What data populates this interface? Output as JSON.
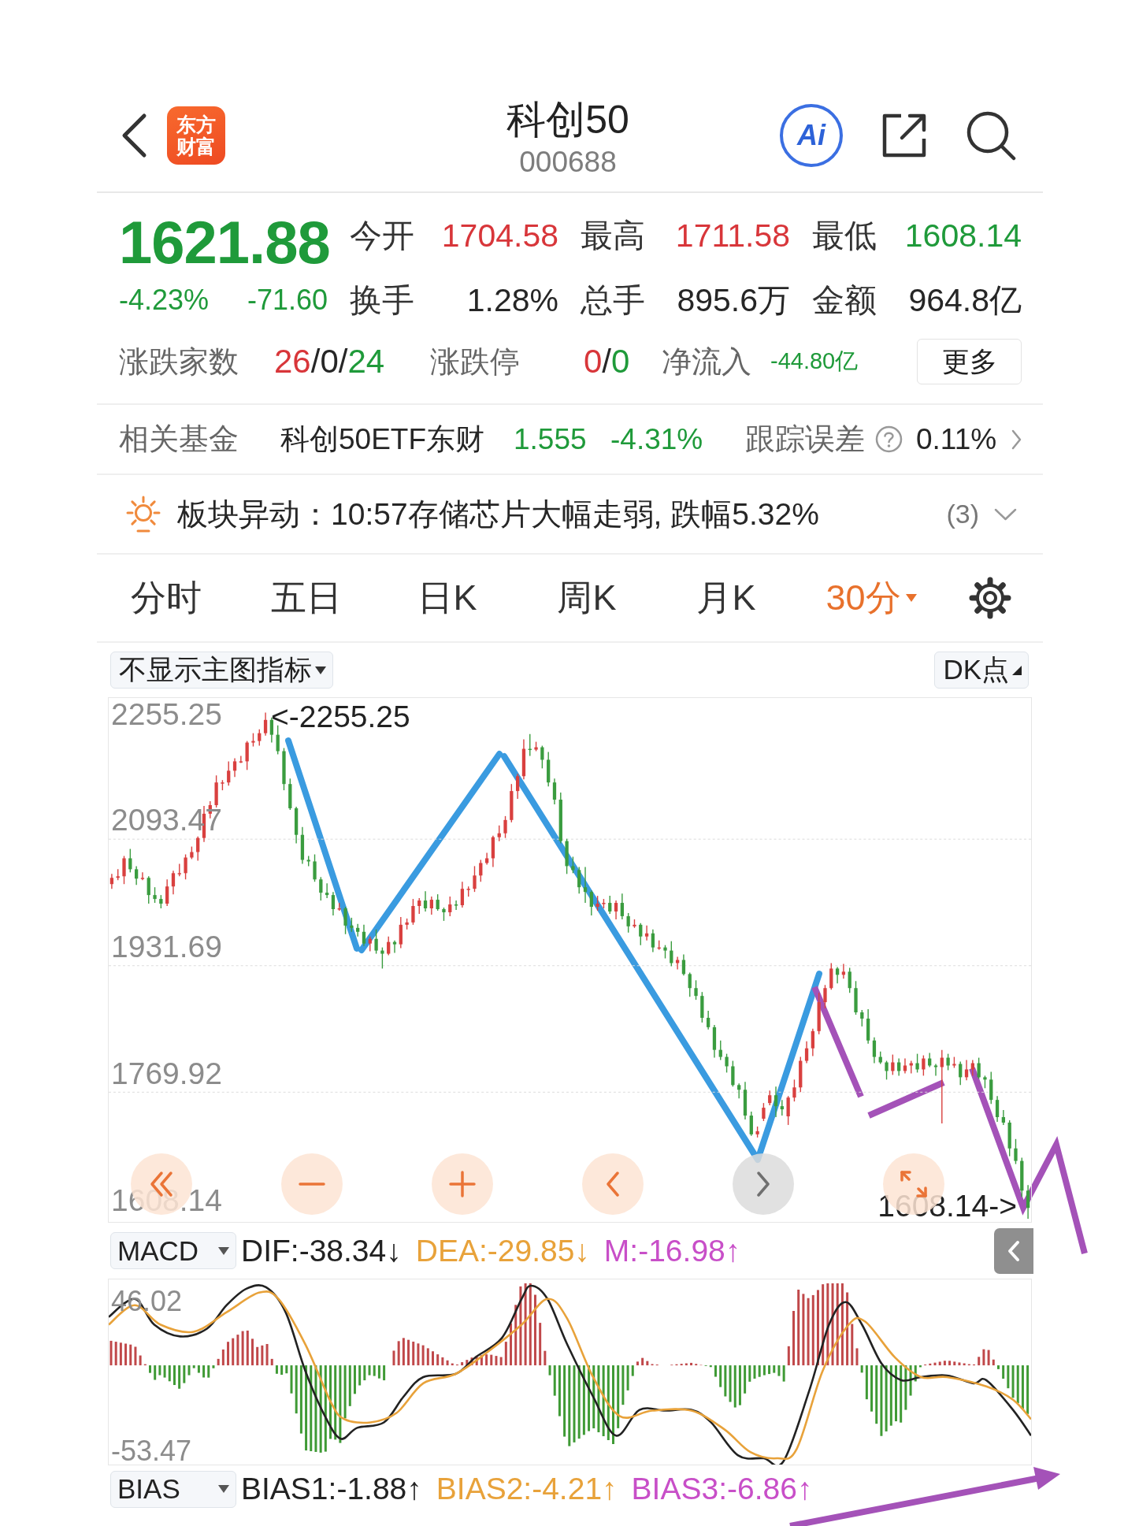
{
  "header": {
    "logo_lines": [
      "东方",
      "财富"
    ],
    "title": "科创50",
    "code": "000688",
    "ai_label": "Ai"
  },
  "quote": {
    "price": "1621.88",
    "change_pct": "-4.23%",
    "change": "-71.60",
    "falling": true,
    "stats": [
      {
        "label": "今开",
        "value": "1704.58",
        "color": "#d8363a"
      },
      {
        "label": "最高",
        "value": "1711.58",
        "color": "#d8363a"
      },
      {
        "label": "最低",
        "value": "1608.14",
        "color": "#1f9a3a"
      },
      {
        "label": "换手",
        "value": "1.28%",
        "color": "#262626"
      },
      {
        "label": "总手",
        "value": "895.6万",
        "color": "#262626"
      },
      {
        "label": "金额",
        "value": "964.8亿",
        "color": "#262626"
      }
    ]
  },
  "breadth": {
    "label": "涨跌家数",
    "counts": [
      {
        "text": "26",
        "color": "#d8363a"
      },
      {
        "text": "/0/",
        "color": "#262626"
      },
      {
        "text": "24",
        "color": "#1f9a3a"
      }
    ],
    "limit_label": "涨跌停",
    "limits": [
      {
        "text": "0",
        "color": "#d8363a"
      },
      {
        "text": "/",
        "color": "#262626"
      },
      {
        "text": "0",
        "color": "#1f9a3a"
      }
    ],
    "inflow_label": "净流入",
    "inflow": "-44.80亿",
    "inflow_falling": true,
    "more_button": "更多"
  },
  "related_fund": {
    "label": "相关基金",
    "name": "科创50ETF东财",
    "price": "1.555",
    "change": "-4.31%",
    "falling": true,
    "tracking_label": "跟踪误差",
    "tracking_error": "0.11%"
  },
  "sector_alert": {
    "text": "板块异动：10:57存储芯片大幅走弱, 跌幅5.32%",
    "count": "(3)"
  },
  "tabs": [
    {
      "label": "分时",
      "selected": false,
      "dropdown": false
    },
    {
      "label": "五日",
      "selected": false,
      "dropdown": false
    },
    {
      "label": "日K",
      "selected": false,
      "dropdown": false
    },
    {
      "label": "周K",
      "selected": false,
      "dropdown": false
    },
    {
      "label": "月K",
      "selected": false,
      "dropdown": false
    },
    {
      "label": "30分",
      "selected": true,
      "dropdown": true
    }
  ],
  "main_indicator": {
    "label": "不显示主图指标"
  },
  "dk_button": {
    "label": "DK点"
  },
  "price_chart": {
    "chart_data": {
      "type": "candlestick",
      "grid": true,
      "ylim": [
        1604,
        2274
      ],
      "yticks": [
        2255.25,
        2093.47,
        1931.69,
        1769.92,
        1608.14
      ],
      "ohlc": [
        [
          2036,
          2049,
          2030,
          2044
        ],
        [
          2044,
          2055,
          2041,
          2046
        ],
        [
          2046,
          2072,
          2036,
          2069
        ],
        [
          2069,
          2081,
          2051,
          2055
        ],
        [
          2055,
          2059,
          2035,
          2043
        ],
        [
          2043,
          2051,
          2041,
          2044
        ],
        [
          2044,
          2046,
          2011,
          2022
        ],
        [
          2022,
          2032,
          2012,
          2017
        ],
        [
          2017,
          2022,
          2005,
          2011
        ],
        [
          2011,
          2042,
          2008,
          2033
        ],
        [
          2033,
          2053,
          2023,
          2050
        ],
        [
          2050,
          2062,
          2046,
          2050
        ],
        [
          2050,
          2074,
          2042,
          2070
        ],
        [
          2070,
          2084,
          2068,
          2077
        ],
        [
          2077,
          2097,
          2066,
          2095
        ],
        [
          2095,
          2136,
          2090,
          2126
        ],
        [
          2126,
          2142,
          2120,
          2137
        ],
        [
          2137,
          2175,
          2134,
          2166
        ],
        [
          2166,
          2169,
          2156,
          2166
        ],
        [
          2166,
          2193,
          2162,
          2181
        ],
        [
          2181,
          2197,
          2173,
          2193
        ],
        [
          2193,
          2200,
          2191,
          2193
        ],
        [
          2193,
          2219,
          2182,
          2217
        ],
        [
          2217,
          2229,
          2212,
          2219
        ],
        [
          2219,
          2234,
          2213,
          2229
        ],
        [
          2229,
          2255.25,
          2226,
          2246
        ],
        [
          2246,
          2249,
          2217,
          2227
        ],
        [
          2227,
          2239,
          2202,
          2206
        ],
        [
          2206,
          2210,
          2156,
          2164
        ],
        [
          2164,
          2171,
          2131,
          2133
        ],
        [
          2133,
          2135,
          2088,
          2099
        ],
        [
          2099,
          2109,
          2062,
          2067
        ],
        [
          2067,
          2072,
          2059,
          2065
        ],
        [
          2065,
          2074,
          2039,
          2042
        ],
        [
          2042,
          2045,
          2015,
          2025
        ],
        [
          2025,
          2037,
          2018,
          2022
        ],
        [
          2022,
          2026,
          1996,
          2004
        ],
        [
          2004,
          2012,
          2002,
          2005
        ],
        [
          2005,
          2007,
          1972,
          1983
        ],
        [
          1983,
          1993,
          1975,
          1980
        ],
        [
          1980,
          1985,
          1969,
          1975
        ],
        [
          1975,
          1984,
          1957,
          1960
        ],
        [
          1960,
          1969,
          1950,
          1966
        ],
        [
          1966,
          1978,
          1947,
          1951
        ],
        [
          1951,
          1955,
          1928,
          1947
        ],
        [
          1947,
          1969,
          1945,
          1962
        ],
        [
          1962,
          1964,
          1948,
          1959
        ],
        [
          1959,
          1994,
          1954,
          1984
        ],
        [
          1984,
          1992,
          1978,
          1987
        ],
        [
          1987,
          2017,
          1984,
          2008
        ],
        [
          2008,
          2018,
          1998,
          2015
        ],
        [
          2015,
          2027,
          2001,
          2005
        ],
        [
          2005,
          2020,
          1997,
          2016
        ],
        [
          2016,
          2023,
          2002,
          2004
        ],
        [
          2004,
          2006,
          1989,
          2000
        ],
        [
          2000,
          2020,
          1995,
          2010
        ],
        [
          2010,
          2015,
          2003,
          2009
        ],
        [
          2009,
          2039,
          2006,
          2030
        ],
        [
          2030,
          2033,
          2020,
          2030
        ],
        [
          2030,
          2059,
          2026,
          2047
        ],
        [
          2047,
          2067,
          2039,
          2063
        ],
        [
          2063,
          2076,
          2061,
          2069
        ],
        [
          2069,
          2098,
          2058,
          2096
        ],
        [
          2096,
          2111,
          2091,
          2101
        ],
        [
          2101,
          2123,
          2095,
          2118
        ],
        [
          2118,
          2164,
          2115,
          2155
        ],
        [
          2155,
          2177,
          2145,
          2174
        ],
        [
          2174,
          2221,
          2170,
          2209
        ],
        [
          2209,
          2228,
          2200,
          2208
        ],
        [
          2208,
          2218,
          2206,
          2211
        ],
        [
          2211,
          2213,
          2184,
          2195
        ],
        [
          2195,
          2205,
          2161,
          2166
        ],
        [
          2166,
          2171,
          2138,
          2144
        ],
        [
          2144,
          2153,
          2088,
          2091
        ],
        [
          2091,
          2094,
          2049,
          2059
        ],
        [
          2059,
          2071,
          2050,
          2054
        ],
        [
          2054,
          2058,
          2024,
          2032
        ],
        [
          2032,
          2058,
          2012,
          2026
        ],
        [
          2026,
          2028,
          1996,
          2007
        ],
        [
          2007,
          2021,
          2002,
          2011
        ],
        [
          2011,
          2017,
          2005,
          2012
        ],
        [
          2012,
          2021,
          1998,
          2001
        ],
        [
          2001,
          2015,
          1991,
          2012
        ],
        [
          2012,
          2024,
          1991,
          1995
        ],
        [
          1995,
          1999,
          1974,
          1982
        ],
        [
          1982,
          1991,
          1980,
          1984
        ],
        [
          1984,
          1986,
          1958,
          1969
        ],
        [
          1969,
          1983,
          1964,
          1973
        ],
        [
          1973,
          1978,
          1949,
          1955
        ],
        [
          1955,
          1964,
          1952,
          1955
        ],
        [
          1955,
          1958,
          1941,
          1951
        ],
        [
          1951,
          1963,
          1931,
          1935
        ],
        [
          1935,
          1943,
          1927,
          1939
        ],
        [
          1939,
          1946,
          1919,
          1921
        ],
        [
          1921,
          1923,
          1892,
          1903
        ],
        [
          1903,
          1913,
          1888,
          1893
        ],
        [
          1893,
          1898,
          1859,
          1865
        ],
        [
          1865,
          1874,
          1850,
          1853
        ],
        [
          1853,
          1856,
          1814,
          1824
        ],
        [
          1824,
          1836,
          1811,
          1815
        ],
        [
          1815,
          1819,
          1795,
          1803
        ],
        [
          1803,
          1810,
          1777,
          1779
        ],
        [
          1779,
          1781,
          1762,
          1773
        ],
        [
          1773,
          1783,
          1735,
          1740
        ],
        [
          1740,
          1745,
          1714,
          1716
        ],
        [
          1716,
          1726,
          1712,
          1720
        ],
        [
          1736,
          1756,
          1733,
          1750
        ],
        [
          1756,
          1772,
          1753,
          1766
        ],
        [
          1766,
          1777,
          1738,
          1752
        ],
        [
          1752,
          1760,
          1740,
          1748
        ],
        [
          1739,
          1765,
          1728,
          1763
        ],
        [
          1763,
          1786,
          1758,
          1776
        ],
        [
          1776,
          1815,
          1770,
          1810
        ],
        [
          1810,
          1835,
          1807,
          1826
        ],
        [
          1826,
          1851,
          1816,
          1848
        ],
        [
          1848,
          1897,
          1844,
          1885
        ],
        [
          1885,
          1907,
          1877,
          1903
        ],
        [
          1903,
          1935,
          1901,
          1928
        ],
        [
          1928,
          1930,
          1909,
          1920
        ],
        [
          1920,
          1934,
          1915,
          1924
        ],
        [
          1924,
          1929,
          1897,
          1903
        ],
        [
          1903,
          1912,
          1869,
          1872
        ],
        [
          1872,
          1875,
          1854,
          1864
        ],
        [
          1864,
          1876,
          1832,
          1836
        ],
        [
          1836,
          1840,
          1807,
          1815
        ],
        [
          1815,
          1822,
          1806,
          1808
        ],
        [
          1808,
          1810,
          1786,
          1797
        ],
        [
          1797,
          1818,
          1792,
          1808
        ],
        [
          1808,
          1813,
          1791,
          1797
        ],
        [
          1797,
          1813,
          1794,
          1804
        ],
        [
          1804,
          1810,
          1794,
          1807
        ],
        [
          1807,
          1819,
          1795,
          1799
        ],
        [
          1799,
          1817,
          1791,
          1813
        ],
        [
          1813,
          1820,
          1802,
          1804
        ],
        [
          1804,
          1806,
          1791,
          1802
        ],
        [
          1802,
          1824,
          1730,
          1814
        ],
        [
          1814,
          1819,
          1798,
          1804
        ],
        [
          1804,
          1815,
          1801,
          1806
        ],
        [
          1806,
          1809,
          1779,
          1789
        ],
        [
          1789,
          1811,
          1785,
          1799
        ],
        [
          1799,
          1811,
          1791,
          1807
        ],
        [
          1807,
          1814,
          1787,
          1789
        ],
        [
          1789,
          1791,
          1775,
          1786
        ],
        [
          1786,
          1796,
          1755,
          1760
        ],
        [
          1760,
          1765,
          1732,
          1738
        ],
        [
          1738,
          1747,
          1728,
          1731
        ],
        [
          1731,
          1734,
          1688,
          1698
        ],
        [
          1698,
          1710,
          1678,
          1682
        ],
        [
          1682,
          1686,
          1636,
          1644
        ],
        [
          1644,
          1651,
          1608.14,
          1621.88
        ]
      ]
    },
    "high_marker": "<-2255.25",
    "low_marker": "1608.14->"
  },
  "chart_buttons": [
    {
      "kind": "rewind",
      "disabled": false
    },
    {
      "kind": "zoom_out",
      "disabled": false
    },
    {
      "kind": "zoom_in",
      "disabled": false
    },
    {
      "kind": "back",
      "disabled": false
    },
    {
      "kind": "forward",
      "disabled": true
    },
    {
      "kind": "fullscreen",
      "disabled": false
    }
  ],
  "macd": {
    "selector": "MACD",
    "values": [
      {
        "text": "DIF:-38.34↓",
        "color": "#222222"
      },
      {
        "text": "DEA:-29.85↓",
        "color": "#e8a23a"
      },
      {
        "text": "M:-16.98↑",
        "color": "#c84fc8"
      }
    ],
    "axis_labels": [
      "46.02",
      "-53.47"
    ]
  },
  "bias": {
    "selector": "BIAS",
    "values": [
      {
        "text": "BIAS1:-1.88↑",
        "color": "#222222"
      },
      {
        "text": "BIAS2:-4.21↑",
        "color": "#e8a23a"
      },
      {
        "text": "BIAS3:-6.86↑",
        "color": "#c84fc8"
      }
    ]
  }
}
